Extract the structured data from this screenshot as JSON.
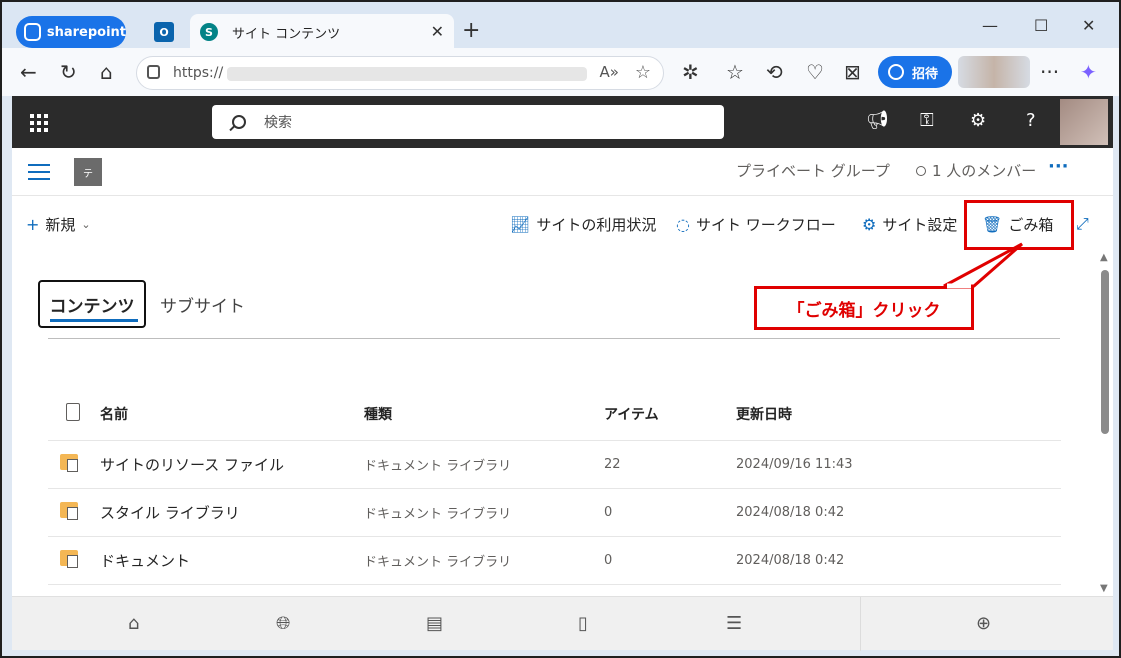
{
  "browser": {
    "profile_label": "sharepoint",
    "outlook_tab_letter": "O",
    "active_tab_title": "サイト コンテンツ",
    "tab_close": "✕",
    "new_tab": "+",
    "url_prefix": "https://",
    "invite_label": "招待",
    "more": "···"
  },
  "suite": {
    "search_placeholder": "検索",
    "help": "?"
  },
  "site": {
    "logo_letter": "テ",
    "group_type": "プライベート グループ",
    "members": "1 人のメンバー",
    "more": "···"
  },
  "commands": {
    "new": "新規",
    "usage": "サイトの利用状況",
    "workflow": "サイト ワークフロー",
    "settings": "サイト設定",
    "recycle": "ごみ箱"
  },
  "annotation": {
    "callout": "「ごみ箱」クリック"
  },
  "pivots": {
    "contents": "コンテンツ",
    "subsites": "サブサイト"
  },
  "table": {
    "columns": [
      "名前",
      "種類",
      "アイテム",
      "更新日時"
    ],
    "rows": [
      {
        "name": "サイトのリソース ファイル",
        "type": "ドキュメント ライブラリ",
        "items": "22",
        "modified": "2024/09/16 11:43"
      },
      {
        "name": "スタイル ライブラリ",
        "type": "ドキュメント ライブラリ",
        "items": "0",
        "modified": "2024/08/18 0:42"
      },
      {
        "name": "ドキュメント",
        "type": "ドキュメント ライブラリ",
        "items": "0",
        "modified": "2024/08/18 0:42"
      }
    ]
  },
  "colors": {
    "accent": "#0f6cbd",
    "suite_bar": "#2b2b2b",
    "annotation_red": "#e00000",
    "edge_blue": "#1a73e8"
  },
  "icons": [
    "search-icon",
    "megaphone-icon",
    "connect-icon",
    "gear-icon",
    "help-icon",
    "waffle-icon",
    "home-icon",
    "globe-icon",
    "news-icon",
    "file-icon",
    "list-icon",
    "add-icon",
    "recycle-bin-icon",
    "expand-icon"
  ]
}
